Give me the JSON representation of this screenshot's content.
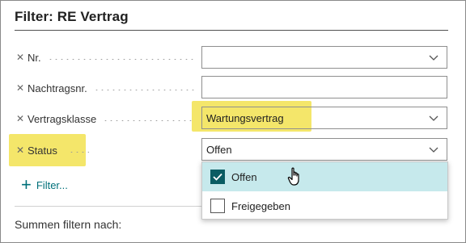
{
  "panel": {
    "title": "Filter: RE Vertrag"
  },
  "fields": [
    {
      "label": "Nr.",
      "value": ""
    },
    {
      "label": "Nachtragsnr.",
      "value": ""
    },
    {
      "label": "Vertragsklasse",
      "value": "Wartungsvertrag"
    },
    {
      "label": "Status",
      "value": "Offen"
    }
  ],
  "add_filter": {
    "label": "Filter..."
  },
  "status_dropdown": {
    "options": [
      {
        "label": "Offen",
        "checked": true
      },
      {
        "label": "Freigegeben",
        "checked": false
      }
    ]
  },
  "footer": {
    "summen_label": "Summen filtern nach:"
  },
  "colors": {
    "highlight": "#f4e66a",
    "accent": "#00707a",
    "selected_row": "#c6e9ec",
    "checkbox_checked": "#0a5c63"
  }
}
